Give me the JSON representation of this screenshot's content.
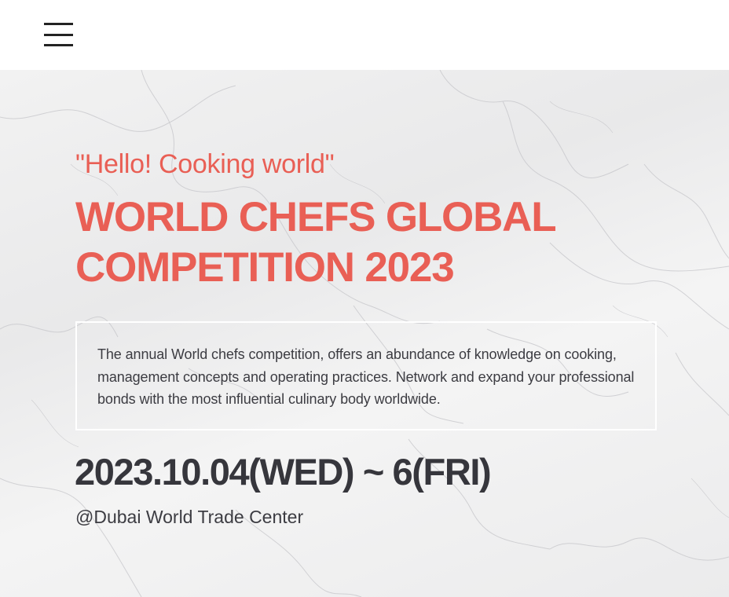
{
  "header": {
    "menu_icon": "hamburger-menu-icon"
  },
  "hero": {
    "tagline": "\"Hello! Cooking world\"",
    "title_line1": "WORLD CHEFS GLOBAL",
    "title_line2": "COMPETITION 2023",
    "description": "The annual World chefs competition, offers an abundance of knowledge on cooking, management concepts and operating practices. Network and expand your professional bonds with the most influential culinary body worldwide.",
    "date": "2023.10.04(WED) ~ 6(FRI)",
    "venue": "@Dubai World Trade Center"
  },
  "colors": {
    "accent": "#e95f55",
    "text_dark": "#36363c",
    "background": "#efefef"
  }
}
